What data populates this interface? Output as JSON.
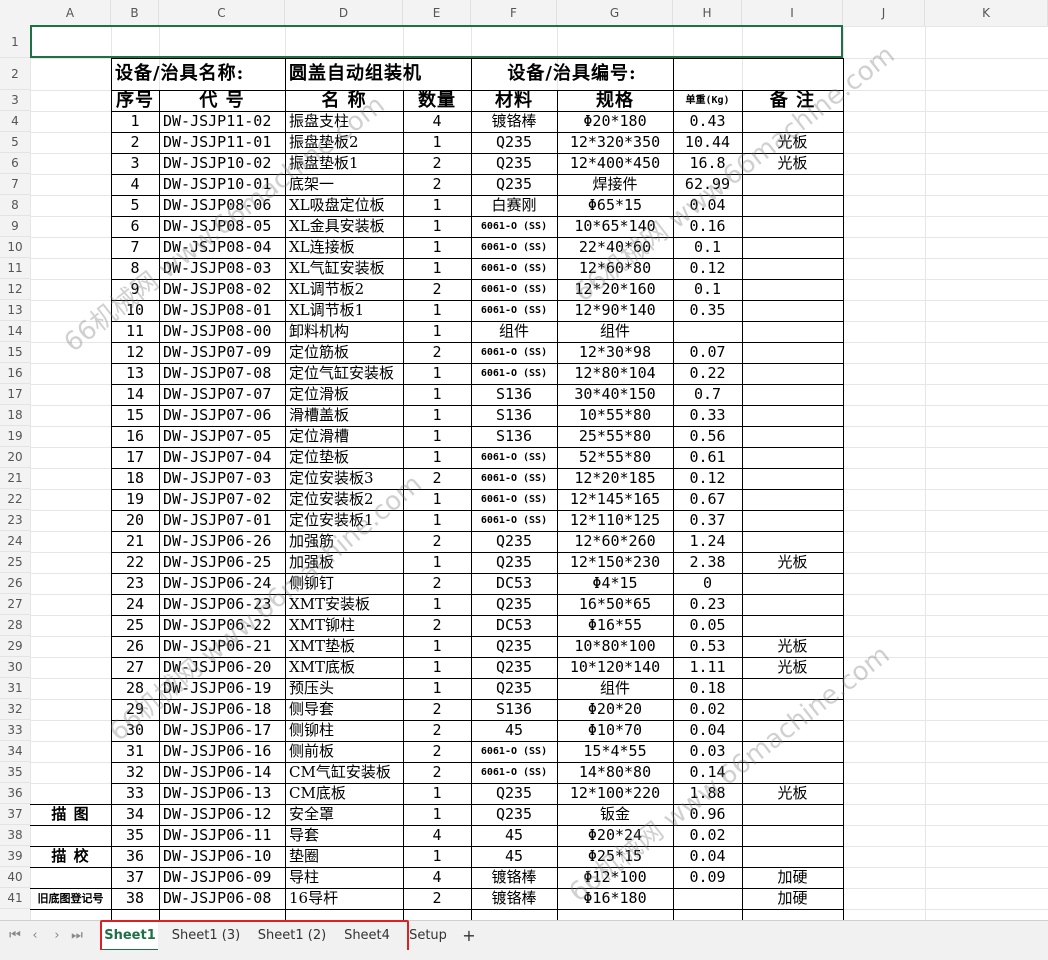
{
  "columns": [
    "A",
    "B",
    "C",
    "D",
    "E",
    "F",
    "G",
    "H",
    "I",
    "J",
    "K"
  ],
  "row_numbers": [
    "1",
    "2",
    "3",
    "4",
    "5",
    "6",
    "7",
    "8",
    "9",
    "10",
    "11",
    "12",
    "13",
    "14",
    "15",
    "16",
    "17",
    "18",
    "19",
    "20",
    "21",
    "22",
    "23",
    "24",
    "25",
    "26",
    "27",
    "28",
    "29",
    "30",
    "31",
    "32",
    "33",
    "34",
    "35",
    "36",
    "37",
    "38",
    "39",
    "40",
    "41"
  ],
  "title_row": {
    "name_label": "设备/治具名称:",
    "name_value": "圆盖自动组装机",
    "number_label": "设备/治具编号:"
  },
  "header_row": {
    "seq": "序号",
    "code": "代 号",
    "name": "名 称",
    "qty": "数量",
    "material": "材料",
    "spec": "规格",
    "weight": "单重(Kg)",
    "remark": "备 注"
  },
  "side_labels": {
    "drawn": "描 图",
    "checked": "描 校",
    "old_no": "旧底图登记号"
  },
  "rows": [
    {
      "seq": "1",
      "code": "DW-JSJP11-02",
      "name": "振盘支柱",
      "qty": "4",
      "material": "镀铬棒",
      "spec": "Φ20*180",
      "weight": "0.43",
      "remark": ""
    },
    {
      "seq": "2",
      "code": "DW-JSJP11-01",
      "name": "振盘垫板2",
      "qty": "1",
      "material": "Q235",
      "spec": "12*320*350",
      "weight": "10.44",
      "remark": "光板"
    },
    {
      "seq": "3",
      "code": "DW-JSJP10-02",
      "name": "振盘垫板1",
      "qty": "2",
      "material": "Q235",
      "spec": "12*400*450",
      "weight": "16.8",
      "remark": "光板"
    },
    {
      "seq": "4",
      "code": "DW-JSJP10-01",
      "name": "底架一",
      "qty": "2",
      "material": "Q235",
      "spec": "焊接件",
      "weight": "62.99",
      "remark": ""
    },
    {
      "seq": "5",
      "code": "DW-JSJP08-06",
      "name": "XL吸盘定位板",
      "qty": "1",
      "material": "白赛刚",
      "spec": "Φ65*15",
      "weight": "0.04",
      "remark": ""
    },
    {
      "seq": "6",
      "code": "DW-JSJP08-05",
      "name": "XL金具安装板",
      "qty": "1",
      "material": "6061-O (SS)",
      "spec": "10*65*140",
      "weight": "0.16",
      "remark": ""
    },
    {
      "seq": "7",
      "code": "DW-JSJP08-04",
      "name": "XL连接板",
      "qty": "1",
      "material": "6061-O (SS)",
      "spec": "22*40*60",
      "weight": "0.1",
      "remark": ""
    },
    {
      "seq": "8",
      "code": "DW-JSJP08-03",
      "name": "XL气缸安装板",
      "qty": "1",
      "material": "6061-O (SS)",
      "spec": "12*60*80",
      "weight": "0.12",
      "remark": ""
    },
    {
      "seq": "9",
      "code": "DW-JSJP08-02",
      "name": "XL调节板2",
      "qty": "2",
      "material": "6061-O (SS)",
      "spec": "12*20*160",
      "weight": "0.1",
      "remark": ""
    },
    {
      "seq": "10",
      "code": "DW-JSJP08-01",
      "name": "XL调节板1",
      "qty": "1",
      "material": "6061-O (SS)",
      "spec": "12*90*140",
      "weight": "0.35",
      "remark": ""
    },
    {
      "seq": "11",
      "code": "DW-JSJP08-00",
      "name": "卸料机构",
      "qty": "1",
      "material": "组件",
      "spec": "组件",
      "weight": "",
      "remark": ""
    },
    {
      "seq": "12",
      "code": "DW-JSJP07-09",
      "name": "定位筋板",
      "qty": "2",
      "material": "6061-O (SS)",
      "spec": "12*30*98",
      "weight": "0.07",
      "remark": ""
    },
    {
      "seq": "13",
      "code": "DW-JSJP07-08",
      "name": "定位气缸安装板",
      "qty": "1",
      "material": "6061-O (SS)",
      "spec": "12*80*104",
      "weight": "0.22",
      "remark": ""
    },
    {
      "seq": "14",
      "code": "DW-JSJP07-07",
      "name": "定位滑板",
      "qty": "1",
      "material": "S136",
      "spec": "30*40*150",
      "weight": "0.7",
      "remark": ""
    },
    {
      "seq": "15",
      "code": "DW-JSJP07-06",
      "name": "滑槽盖板",
      "qty": "1",
      "material": "S136",
      "spec": "10*55*80",
      "weight": "0.33",
      "remark": ""
    },
    {
      "seq": "16",
      "code": "DW-JSJP07-05",
      "name": "定位滑槽",
      "qty": "1",
      "material": "S136",
      "spec": "25*55*80",
      "weight": "0.56",
      "remark": ""
    },
    {
      "seq": "17",
      "code": "DW-JSJP07-04",
      "name": "定位垫板",
      "qty": "1",
      "material": "6061-O (SS)",
      "spec": "52*55*80",
      "weight": "0.61",
      "remark": ""
    },
    {
      "seq": "18",
      "code": "DW-JSJP07-03",
      "name": "定位安装板3",
      "qty": "2",
      "material": "6061-O (SS)",
      "spec": "12*20*185",
      "weight": "0.12",
      "remark": ""
    },
    {
      "seq": "19",
      "code": "DW-JSJP07-02",
      "name": "定位安装板2",
      "qty": "1",
      "material": "6061-O (SS)",
      "spec": "12*145*165",
      "weight": "0.67",
      "remark": ""
    },
    {
      "seq": "20",
      "code": "DW-JSJP07-01",
      "name": "定位安装板1",
      "qty": "1",
      "material": "6061-O (SS)",
      "spec": "12*110*125",
      "weight": "0.37",
      "remark": ""
    },
    {
      "seq": "21",
      "code": "DW-JSJP06-26",
      "name": "加强筋",
      "qty": "2",
      "material": "Q235",
      "spec": "12*60*260",
      "weight": "1.24",
      "remark": ""
    },
    {
      "seq": "22",
      "code": "DW-JSJP06-25",
      "name": "加强板",
      "qty": "1",
      "material": "Q235",
      "spec": "12*150*230",
      "weight": "2.38",
      "remark": "光板"
    },
    {
      "seq": "23",
      "code": "DW-JSJP06-24",
      "name": "侧铆钉",
      "qty": "2",
      "material": "DC53",
      "spec": "Φ4*15",
      "weight": "0",
      "remark": ""
    },
    {
      "seq": "24",
      "code": "DW-JSJP06-23",
      "name": "XMT安装板",
      "qty": "1",
      "material": "Q235",
      "spec": "16*50*65",
      "weight": "0.23",
      "remark": ""
    },
    {
      "seq": "25",
      "code": "DW-JSJP06-22",
      "name": "XMT铆柱",
      "qty": "2",
      "material": "DC53",
      "spec": "Φ16*55",
      "weight": "0.05",
      "remark": ""
    },
    {
      "seq": "26",
      "code": "DW-JSJP06-21",
      "name": "XMT垫板",
      "qty": "1",
      "material": "Q235",
      "spec": "10*80*100",
      "weight": "0.53",
      "remark": "光板"
    },
    {
      "seq": "27",
      "code": "DW-JSJP06-20",
      "name": "XMT底板",
      "qty": "1",
      "material": "Q235",
      "spec": "10*120*140",
      "weight": "1.11",
      "remark": "光板"
    },
    {
      "seq": "28",
      "code": "DW-JSJP06-19",
      "name": "预压头",
      "qty": "1",
      "material": "Q235",
      "spec": "组件",
      "weight": "0.18",
      "remark": ""
    },
    {
      "seq": "29",
      "code": "DW-JSJP06-18",
      "name": "侧导套",
      "qty": "2",
      "material": "S136",
      "spec": "Φ20*20",
      "weight": "0.02",
      "remark": ""
    },
    {
      "seq": "30",
      "code": "DW-JSJP06-17",
      "name": "侧铆柱",
      "qty": "2",
      "material": "45",
      "spec": "Φ10*70",
      "weight": "0.04",
      "remark": ""
    },
    {
      "seq": "31",
      "code": "DW-JSJP06-16",
      "name": "侧前板",
      "qty": "2",
      "material": "6061-O (SS)",
      "spec": "15*4*55",
      "weight": "0.03",
      "remark": ""
    },
    {
      "seq": "32",
      "code": "DW-JSJP06-14",
      "name": "CM气缸安装板",
      "qty": "2",
      "material": "6061-O (SS)",
      "spec": "14*80*80",
      "weight": "0.14",
      "remark": ""
    },
    {
      "seq": "33",
      "code": "DW-JSJP06-13",
      "name": "CM底板",
      "qty": "1",
      "material": "Q235",
      "spec": "12*100*220",
      "weight": "1.88",
      "remark": "光板"
    },
    {
      "seq": "34",
      "code": "DW-JSJP06-12",
      "name": "安全罩",
      "qty": "1",
      "material": "Q235",
      "spec": "钣金",
      "weight": "0.96",
      "remark": ""
    },
    {
      "seq": "35",
      "code": "DW-JSJP06-11",
      "name": "导套",
      "qty": "4",
      "material": "45",
      "spec": "Φ20*24",
      "weight": "0.02",
      "remark": ""
    },
    {
      "seq": "36",
      "code": "DW-JSJP06-10",
      "name": "垫圈",
      "qty": "1",
      "material": "45",
      "spec": "Φ25*15",
      "weight": "0.04",
      "remark": ""
    },
    {
      "seq": "37",
      "code": "DW-JSJP06-09",
      "name": "导柱",
      "qty": "4",
      "material": "镀铬棒",
      "spec": "Φ12*100",
      "weight": "0.09",
      "remark": "加硬"
    },
    {
      "seq": "38",
      "code": "DW-JSJP06-08",
      "name": "16导杆",
      "qty": "2",
      "material": "镀铬棒",
      "spec": "Φ16*180",
      "weight": "",
      "remark": "加硬"
    }
  ],
  "sheet_tabs": [
    {
      "label": "Sheet1",
      "active": true
    },
    {
      "label": "Sheet1 (3)",
      "active": false
    },
    {
      "label": "Sheet1 (2)",
      "active": false
    },
    {
      "label": "Sheet4",
      "active": false
    },
    {
      "label": "Setup",
      "active": false
    }
  ],
  "add_sheet_label": "+",
  "watermarks": [
    "66机械网 www.66machine.com",
    "66机械网 www.66machine.com",
    "66机械网 www.66machine.com",
    "66机械网 www.66machine.com"
  ],
  "colors": {
    "selection": "#1e7145",
    "highlight_box": "#e02020",
    "grid": "#e6e6e6"
  }
}
